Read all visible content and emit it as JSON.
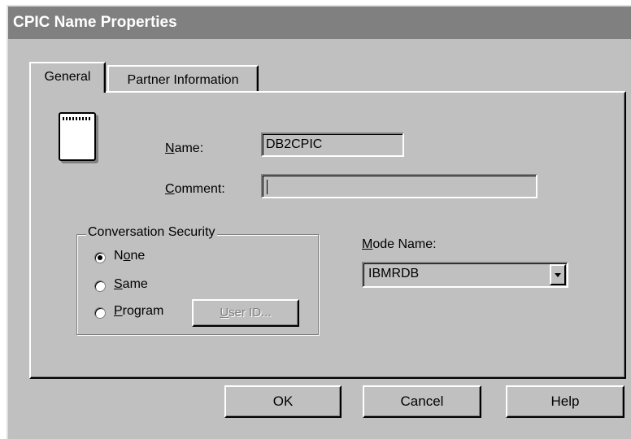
{
  "window": {
    "title": "CPIC Name Properties"
  },
  "tabs": [
    {
      "label": "General",
      "active": true
    },
    {
      "label": "Partner Information",
      "active": false
    }
  ],
  "general": {
    "icon": "notepad-icon",
    "name": {
      "label_pre": "",
      "label_ul": "N",
      "label_post": "ame:",
      "value": "DB2CPIC"
    },
    "comment": {
      "label_pre": "",
      "label_ul": "C",
      "label_post": "omment:",
      "value": ""
    },
    "conversation_security": {
      "legend": "Conversation Security",
      "options": [
        {
          "pre": "N",
          "ul": "o",
          "post": "ne",
          "selected": true
        },
        {
          "pre": "",
          "ul": "S",
          "post": "ame",
          "selected": false
        },
        {
          "pre": "",
          "ul": "P",
          "post": "rogram",
          "selected": false
        }
      ],
      "userid_button": {
        "pre": "",
        "ul": "U",
        "post": "ser ID...",
        "enabled": false
      }
    },
    "mode_name": {
      "label_pre": "",
      "label_ul": "M",
      "label_post": "ode Name:",
      "value": "IBMRDB"
    }
  },
  "buttons": {
    "ok": "OK",
    "cancel": "Cancel",
    "help": "Help"
  },
  "colors": {
    "face": "#c0c0c0",
    "title_bg": "#808080",
    "title_fg": "#ffffff"
  }
}
